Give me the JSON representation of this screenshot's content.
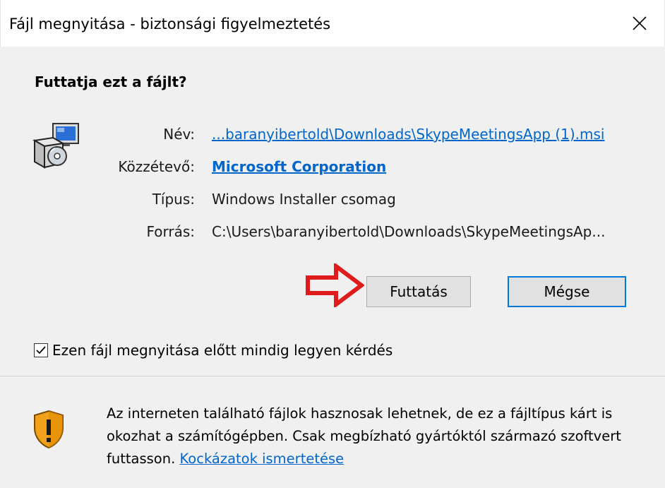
{
  "window": {
    "title": "Fájl megnyitása - biztonsági figyelmeztetés",
    "close_glyph": "✕"
  },
  "dialog": {
    "question": "Futtatja ezt a fájlt?",
    "file_icon": "installer-package-icon",
    "fields": {
      "name_label": "Név:",
      "name_value": "...baranyibertold\\Downloads\\SkypeMeetingsApp (1).msi",
      "publisher_label": "Közzétevő:",
      "publisher_value": "Microsoft Corporation",
      "type_label": "Típus:",
      "type_value": "Windows Installer csomag",
      "source_label": "Forrás:",
      "source_value": "C:\\Users\\baranyibertold\\Downloads\\SkypeMeetingsAp..."
    },
    "buttons": {
      "run": "Futtatás",
      "cancel": "Mégse"
    },
    "checkbox": {
      "label": "Ezen fájl megnyitása előtt mindig legyen kérdés",
      "checked": true
    },
    "warning": {
      "icon": "shield-warning-icon",
      "text_before_link": "Az interneten található fájlok hasznosak lehetnek, de ez a fájltípus kárt is okozhat a számítógépben. Csak megbízható gyártóktól származó szoftvert futtasson.",
      "link": "Kockázatok ismertetése"
    }
  },
  "annotation": {
    "arrow_color": "#e01b1b",
    "points_to": "run-button"
  },
  "colors": {
    "link": "#0066cc",
    "default_button_border": "#0078d7",
    "background": "#f0f0f0"
  }
}
